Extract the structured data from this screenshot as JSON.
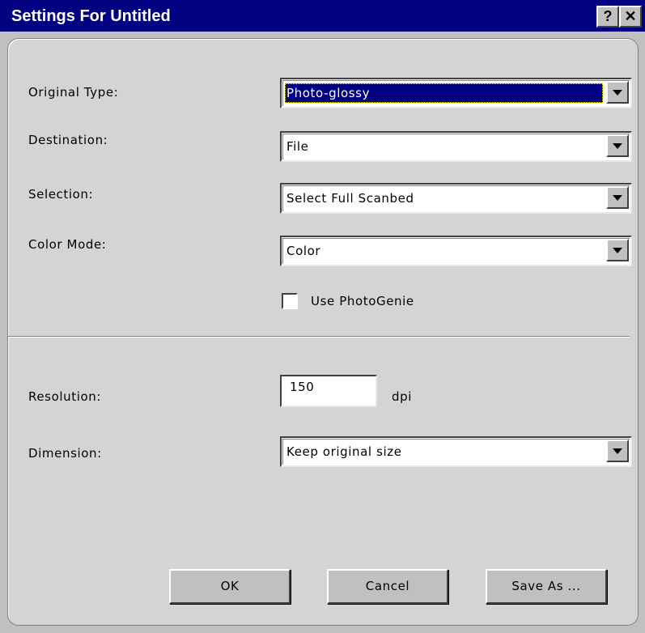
{
  "window": {
    "title": "Settings For Untitled",
    "help_label": "?",
    "close_label": "✕"
  },
  "fields": {
    "original_type": {
      "label": "Original Type:",
      "value": "Photo-glossy"
    },
    "destination": {
      "label": "Destination:",
      "value": "File"
    },
    "selection": {
      "label": "Selection:",
      "value": "Select Full Scanbed"
    },
    "color_mode": {
      "label": "Color Mode:",
      "value": "Color"
    },
    "use_photogenie": {
      "label": "Use PhotoGenie",
      "checked": false
    },
    "resolution": {
      "label": "Resolution:",
      "value": "150",
      "unit": "dpi"
    },
    "dimension": {
      "label": "Dimension:",
      "value": "Keep original size"
    }
  },
  "buttons": {
    "ok": "OK",
    "cancel": "Cancel",
    "save_as": "Save As ..."
  },
  "colors": {
    "titlebar": "#000080",
    "face": "#c0c0c0",
    "selection_highlight": "#000080"
  }
}
